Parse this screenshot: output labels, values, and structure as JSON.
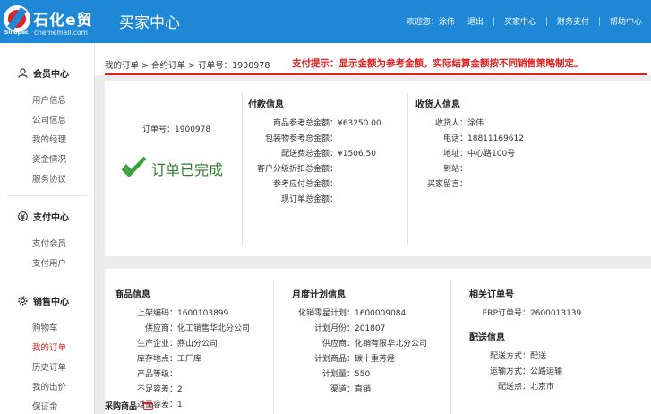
{
  "brand": {
    "name": "石化e贸",
    "sub": "Sinopec",
    "domain": "chememall.com"
  },
  "header": {
    "title": "买家中心",
    "welcome_prefix": "欢迎您：",
    "user": "涂伟",
    "logout": "退出",
    "links": [
      "买家中心",
      "财务支付",
      "帮助中心"
    ]
  },
  "sidebar": {
    "groups": [
      {
        "title": "会员中心",
        "icon": "user-icon",
        "items": [
          "用户信息",
          "公司信息",
          "我的经理",
          "资金情况",
          "服务协议"
        ]
      },
      {
        "title": "支付中心",
        "icon": "yen-icon",
        "items": [
          "支付会员",
          "支付用户"
        ]
      },
      {
        "title": "销售中心",
        "icon": "gear-icon",
        "items": [
          "购物车",
          "我的订单",
          "历史订单",
          "我的出价",
          "保证金"
        ]
      }
    ],
    "active_item": "我的订单"
  },
  "breadcrumb": [
    "我的订单",
    "合约订单",
    "订单号：1900978"
  ],
  "tip": "支付提示：显示金额为参考金额，实际结算金额按不同销售策略制定。",
  "order": {
    "number_label": "订单号：",
    "number": "1900978",
    "status": "订单已完成"
  },
  "payment": {
    "title": "付款信息",
    "rows": [
      {
        "k": "商品参考总金额：",
        "v": "¥63250.00"
      },
      {
        "k": "包装物参考总金额：",
        "v": ""
      },
      {
        "k": "配送费总金额：",
        "v": "¥1506.50"
      },
      {
        "k": "客户分级折扣总金额：",
        "v": ""
      },
      {
        "k": "参考应付总金额：",
        "v": ""
      },
      {
        "k": "现订单总金额：",
        "v": ""
      }
    ]
  },
  "receiver": {
    "title": "收货人信息",
    "rows": [
      {
        "k": "收货人：",
        "v": "涂伟"
      },
      {
        "k": "电话：",
        "v": "18811169612"
      },
      {
        "k": "地址：",
        "v": "中心路100号"
      },
      {
        "k": "到站：",
        "v": ""
      },
      {
        "k": "买家留言：",
        "v": ""
      }
    ]
  },
  "goods": {
    "title": "商品信息",
    "rows": [
      {
        "k": "上架编码：",
        "v": "1600103899"
      },
      {
        "k": "供应商：",
        "v": "化工销售华北分公司"
      },
      {
        "k": "生产企业：",
        "v": "燕山分公司"
      },
      {
        "k": "库存地点：",
        "v": "工厂库"
      },
      {
        "k": "产品等级：",
        "v": ""
      },
      {
        "k": "不足容差：",
        "v": "2"
      },
      {
        "k": "过量容差：",
        "v": "1"
      }
    ]
  },
  "plan": {
    "title": "月度计划信息",
    "rows": [
      {
        "k": "化销零星计划：",
        "v": "1600009084"
      },
      {
        "k": "计划月份：",
        "v": "201807"
      },
      {
        "k": "供应商：",
        "v": "化销有限华北分公司"
      },
      {
        "k": "计划商品：",
        "v": "碳十重芳烃"
      },
      {
        "k": "计划量：",
        "v": "550"
      },
      {
        "k": "渠道：",
        "v": "直销"
      }
    ]
  },
  "related": {
    "title": "相关订单号",
    "rows": [
      {
        "k": "ERP订单号：",
        "v": "2600013139"
      }
    ]
  },
  "delivery": {
    "title": "配送信息",
    "rows": [
      {
        "k": "配送方式：",
        "v": "配送"
      },
      {
        "k": "运输方式：",
        "v": "公路运输"
      },
      {
        "k": "配送点：",
        "v": "北京市"
      }
    ]
  },
  "purchase_title": "采购商品"
}
